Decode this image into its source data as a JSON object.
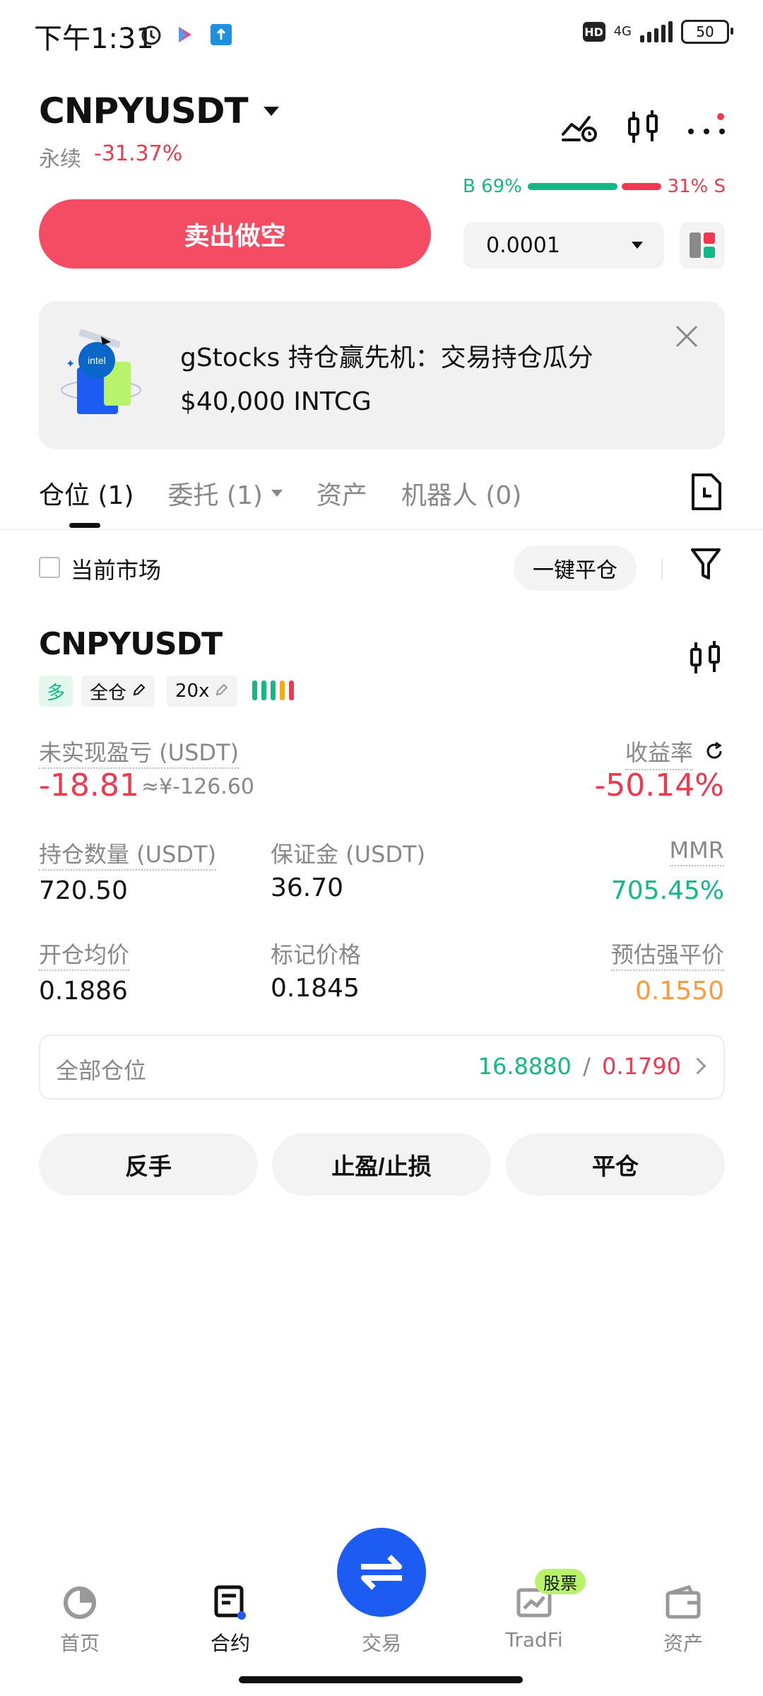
{
  "status_bar": {
    "time": "下午1:31",
    "network": "4G",
    "hd": "HD",
    "battery": "50"
  },
  "header": {
    "symbol": "CNPYUSDT",
    "contract_type": "永续",
    "change": "-31.37%"
  },
  "trade_strip": {
    "buy_ratio": "B 69%",
    "sell_ratio": "31% S",
    "buy_ratio_value": 69,
    "sell_label": "卖出做空",
    "qty_value": "0.0001"
  },
  "banner": {
    "line1": "gStocks 持仓赢先机：交易持仓瓜分",
    "line2": "$40,000 INTCG"
  },
  "tabs": [
    {
      "label": "仓位 (1)"
    },
    {
      "label": "委托 (1)"
    },
    {
      "label": "资产"
    },
    {
      "label": "机器人 (0)"
    }
  ],
  "filter": {
    "current_market": "当前市场",
    "close_all": "一键平仓"
  },
  "position": {
    "symbol": "CNPYUSDT",
    "side_tag": "多",
    "margin_mode": "全仓",
    "leverage": "20x",
    "unrealized_pnl_label": "未实现盈亏 (USDT)",
    "unrealized_pnl": "-18.81",
    "unrealized_pnl_cny": "≈¥-126.60",
    "roe_label": "收益率",
    "roe": "-50.14%",
    "size_label": "持仓数量 (USDT)",
    "size": "720.50",
    "margin_label": "保证金 (USDT)",
    "margin": "36.70",
    "mmr_label": "MMR",
    "mmr": "705.45%",
    "entry_label": "开仓均价",
    "entry": "0.1886",
    "mark_label": "标记价格",
    "mark": "0.1845",
    "liq_label": "预估强平价",
    "liq": "0.1550",
    "all_positions_label": "全部仓位",
    "all_positions_tp": "16.8880",
    "all_positions_sep": "/",
    "all_positions_sl": "0.1790",
    "actions": [
      "反手",
      "止盈/止损",
      "平仓"
    ]
  },
  "bottom_nav": {
    "items": [
      {
        "label": "首页"
      },
      {
        "label": "合约"
      },
      {
        "label": "交易"
      },
      {
        "label": "TradFi"
      },
      {
        "label": "资产"
      }
    ],
    "badge": "股票"
  },
  "colors": {
    "red": "#f0384f",
    "green": "#12b886",
    "orange": "#ff9a3c",
    "blue": "#1c5cf3"
  }
}
